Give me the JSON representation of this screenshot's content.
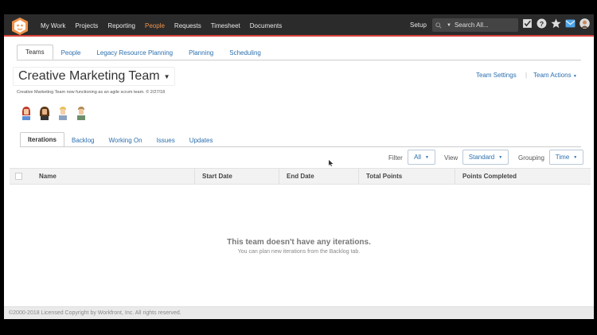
{
  "nav": {
    "items": [
      {
        "label": "My Work",
        "active": false
      },
      {
        "label": "Projects",
        "active": false
      },
      {
        "label": "Reporting",
        "active": false
      },
      {
        "label": "People",
        "active": true
      },
      {
        "label": "Requests",
        "active": false
      },
      {
        "label": "Timesheet",
        "active": false
      },
      {
        "label": "Documents",
        "active": false
      }
    ],
    "setup": "Setup",
    "search_placeholder": "Search All...",
    "active_color": "#f0924a",
    "bar_color": "#2b2b2b",
    "accent_line": "#d9403a"
  },
  "main_tabs": [
    "Teams",
    "People",
    "Legacy Resource Planning",
    "Planning",
    "Scheduling"
  ],
  "team": {
    "title": "Creative Marketing Team",
    "description": "Creative Marketing Team now functioning as an agile scrum team. © 2/27/18",
    "settings_label": "Team Settings",
    "actions_label": "Team Actions"
  },
  "sub_tabs": [
    "Iterations",
    "Backlog",
    "Working On",
    "Issues",
    "Updates"
  ],
  "filters": {
    "filter_label": "Filter",
    "filter_value": "All",
    "view_label": "View",
    "view_value": "Standard",
    "grouping_label": "Grouping",
    "grouping_value": "Time"
  },
  "table": {
    "columns": [
      "Name",
      "Start Date",
      "End Date",
      "Total Points",
      "Points Completed"
    ]
  },
  "empty_state": {
    "title": "This team doesn't have any iterations.",
    "subtitle": "You can plan new iterations from the Backlog tab."
  },
  "footer": {
    "copyright": "©2000-2018 Licensed Copyright by Workfront, Inc. All rights reserved."
  },
  "link_color": "#2b6fae"
}
